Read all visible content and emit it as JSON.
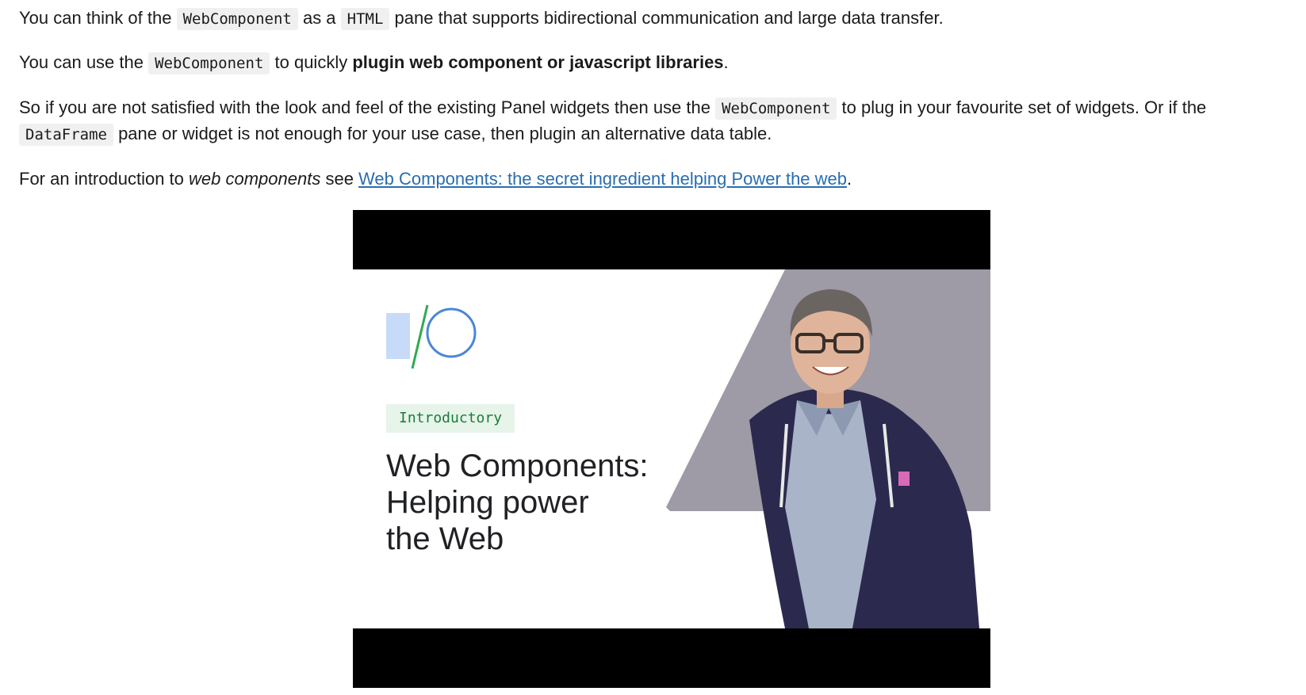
{
  "paragraphs": {
    "p1": {
      "t1": "You can think of the ",
      "code1": "WebComponent",
      "t2": " as a ",
      "code2": "HTML",
      "t3": " pane that supports bidirectional communication and large data transfer."
    },
    "p2": {
      "t1": "You can use the ",
      "code1": "WebComponent",
      "t2": " to quickly ",
      "bold": "plugin web component or javascript libraries",
      "t3": "."
    },
    "p3": {
      "t1": "So if you are not satisfied with the look and feel of the existing Panel widgets then use the ",
      "code1": "WebComponent",
      "t2": " to plug in your favourite set of widgets. Or if the",
      "code2": "DataFrame",
      "t3": " pane or widget is not enough for your use case, then plugin an alternative data table."
    },
    "p4": {
      "t1": "For an introduction to ",
      "em": "web components",
      "t2": " see ",
      "link": "Web Components: the secret ingredient helping Power the web",
      "t3": "."
    }
  },
  "video": {
    "badge": "Introductory",
    "title": "Web Components:\nHelping power\nthe Web",
    "logo_icon": "google-io-logo-icon",
    "colors": {
      "logo_blue": "#4a86d8",
      "logo_green": "#34a853",
      "badge_bg": "#e6f4ea",
      "gray_panel": "#9e9aa6"
    }
  }
}
